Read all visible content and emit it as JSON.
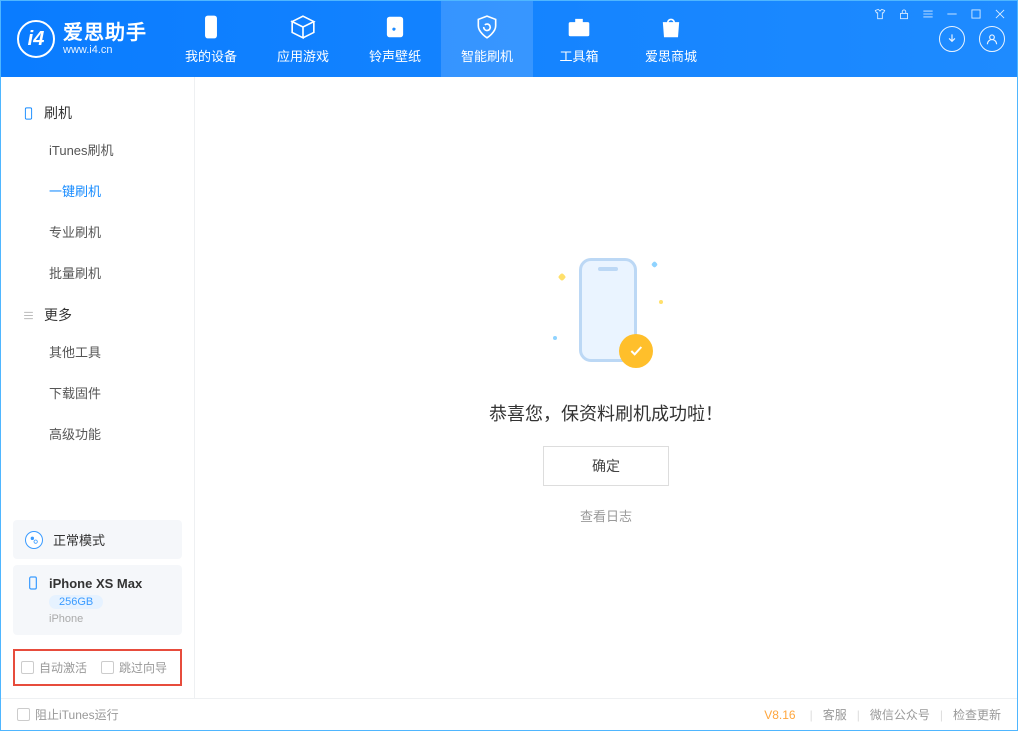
{
  "app": {
    "name": "爱思助手",
    "url": "www.i4.cn"
  },
  "nav": {
    "items": [
      {
        "label": "我的设备"
      },
      {
        "label": "应用游戏"
      },
      {
        "label": "铃声壁纸"
      },
      {
        "label": "智能刷机"
      },
      {
        "label": "工具箱"
      },
      {
        "label": "爱思商城"
      }
    ]
  },
  "sidebar": {
    "section1": {
      "title": "刷机",
      "items": [
        "iTunes刷机",
        "一键刷机",
        "专业刷机",
        "批量刷机"
      ]
    },
    "section2": {
      "title": "更多",
      "items": [
        "其他工具",
        "下载固件",
        "高级功能"
      ]
    },
    "mode": "正常模式",
    "device": {
      "name": "iPhone XS Max",
      "capacity": "256GB",
      "type": "iPhone"
    },
    "opts": {
      "auto_activate": "自动激活",
      "skip_guide": "跳过向导"
    }
  },
  "main": {
    "message": "恭喜您，保资料刷机成功啦！",
    "ok": "确定",
    "log": "查看日志"
  },
  "footer": {
    "block_itunes": "阻止iTunes运行",
    "version": "V8.16",
    "links": [
      "客服",
      "微信公众号",
      "检查更新"
    ]
  }
}
